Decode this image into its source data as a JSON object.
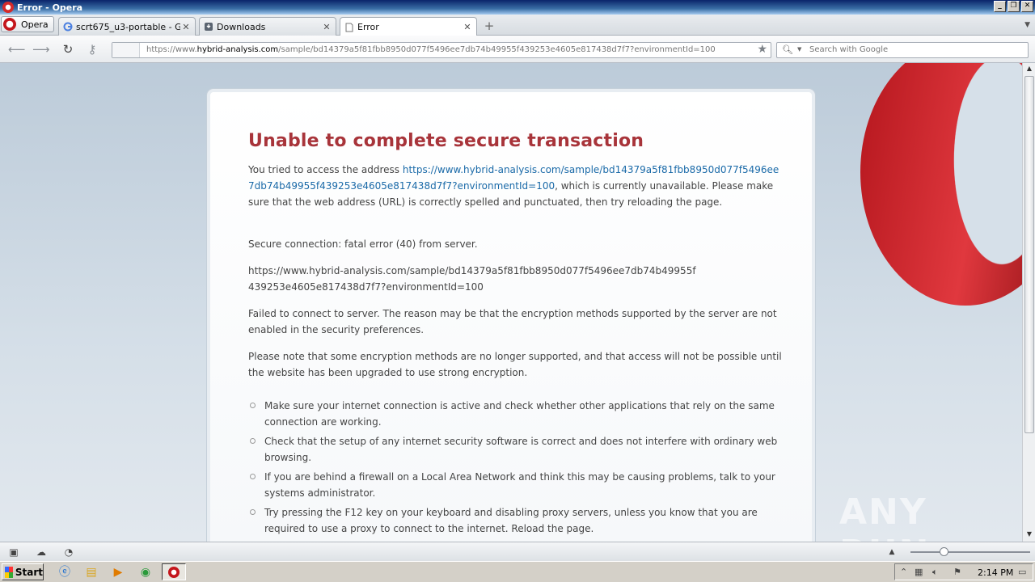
{
  "window": {
    "title": "Error - Opera"
  },
  "menu_button": {
    "label": "Opera"
  },
  "tabs": [
    {
      "title": "scrt675_u3-portable - G...",
      "icon": "google-icon"
    },
    {
      "title": "Downloads",
      "icon": "download-icon"
    },
    {
      "title": "Error",
      "icon": "page-icon",
      "active": true
    }
  ],
  "address_bar": {
    "url_prefix": "https://www.",
    "url_host": "hybrid-analysis.com",
    "url_path": "/sample/bd14379a5f81fbb8950d077f5496ee7db74b49955f439253e4605e817438d7f7?environmentId=100"
  },
  "search": {
    "placeholder": "Search with Google"
  },
  "error": {
    "title": "Unable to complete secure transaction",
    "p1_before": "You tried to access the address ",
    "p1_link": "https://www.hybrid-analysis.com/sample/bd14379a5f81fbb8950d077f5496ee7db74b49955f439253e4605e817438d7f7?environmentId=100",
    "p1_after": ", which is currently unavailable. Please make sure that the web address (URL) is correctly spelled and punctuated, then try reloading the page.",
    "p2": "Secure connection: fatal error (40) from server.",
    "p3": "https://www.hybrid-analysis.com/sample/bd14379a5f81fbb8950d077f5496ee7db74b49955f439253e4605e817438d7f7?environmentId=100",
    "p4": "Failed to connect to server. The reason may be that the encryption methods supported by the server are not enabled in the security preferences.",
    "p5": "Please note that some encryption methods are no longer supported, and that access will not be possible until the website has been upgraded to use strong encryption.",
    "tips": [
      "Make sure your internet connection is active and check whether other applications that rely on the same connection are working.",
      "Check that the setup of any internet security software is correct and does not interfere with ordinary web browsing.",
      "If you are behind a firewall on a Local Area Network and think this may be causing problems, talk to your systems administrator.",
      "Try pressing the F12 key on your keyboard and disabling proxy servers, unless you know that you are required to use a proxy to connect to the internet. Reload the page."
    ]
  },
  "watermark": {
    "text": "ANY RUN"
  },
  "taskbar": {
    "start_label": "Start",
    "clock": "2:14 PM"
  },
  "colors": {
    "error_title": "#a8343a",
    "link": "#1a6aa8",
    "opera_red": "#c4161c"
  }
}
